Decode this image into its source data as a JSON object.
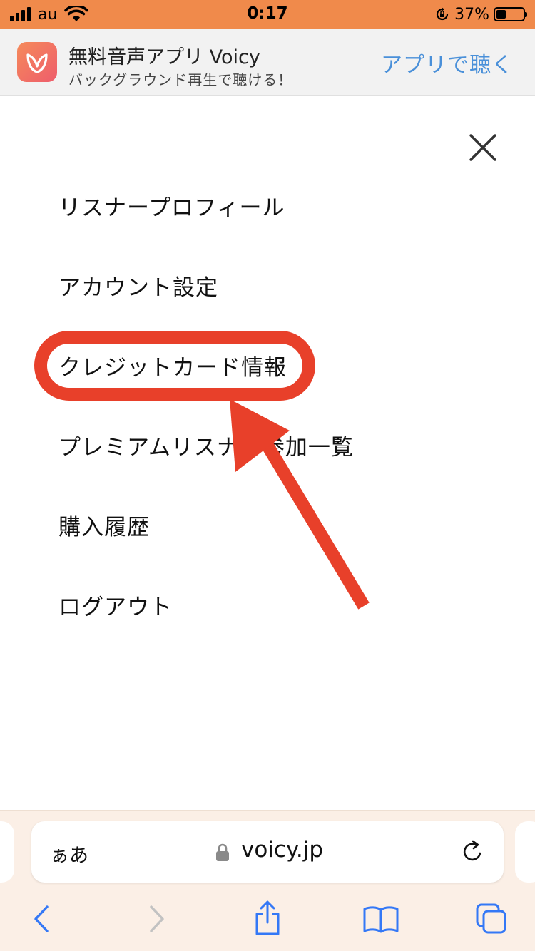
{
  "status_bar": {
    "carrier": "au",
    "time": "0:17",
    "battery_percent_text": "37%",
    "battery_level": 0.37
  },
  "app_banner": {
    "app_name": "無料音声アプリ Voicy",
    "subtitle": "バックグラウンド再生で聴ける！",
    "action_label": "アプリで聴く",
    "icon": "voicy-logo"
  },
  "menu": {
    "close_icon": "close-icon",
    "items": [
      {
        "label": "リスナープロフィール"
      },
      {
        "label": "アカウント設定"
      },
      {
        "label": "クレジットカード情報"
      },
      {
        "label": "プレミアムリスナー参加一覧"
      },
      {
        "label": "購入履歴"
      },
      {
        "label": "ログアウト"
      }
    ]
  },
  "annotation": {
    "highlighted_item": "クレジットカード情報",
    "color": "#e8402a"
  },
  "browser": {
    "text_size_label": "ぁあ",
    "domain": "voicy.jp",
    "icons": [
      "back-icon",
      "forward-icon",
      "share-icon",
      "bookmarks-icon",
      "tabs-icon"
    ]
  },
  "colors": {
    "status_bar": "#f08a4b",
    "accent_link": "#4a90d9",
    "toolbar_icon": "#3478f6",
    "annotation": "#e8402a"
  }
}
